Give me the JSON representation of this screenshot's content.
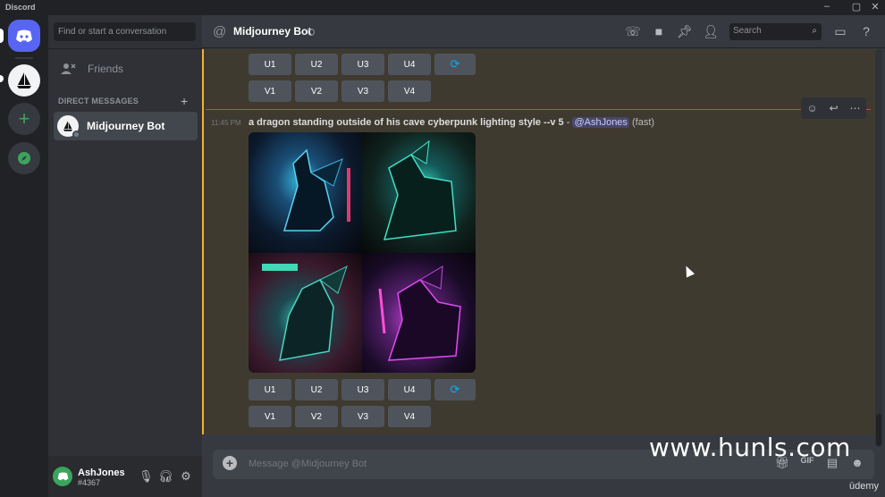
{
  "app": {
    "title": "Discord"
  },
  "dm_search": {
    "placeholder": "Find or start a conversation"
  },
  "friends_label": "Friends",
  "direct_messages_header": "DIRECT MESSAGES",
  "dm_list": [
    {
      "name": "Midjourney Bot"
    }
  ],
  "user": {
    "name": "AshJones",
    "tag": "#4367"
  },
  "channel": {
    "title": "Midjourney Bot"
  },
  "header_search": {
    "placeholder": "Search"
  },
  "upscale_buttons": [
    "U1",
    "U2",
    "U3",
    "U4"
  ],
  "variation_buttons": [
    "V1",
    "V2",
    "V3",
    "V4"
  ],
  "message": {
    "timestamp": "11:45 PM",
    "prompt": "a dragon standing outside of his cave cyberpunk lighting style --v 5",
    "separator": " - ",
    "mention": "@AshJones",
    "mode": "(fast)"
  },
  "composer": {
    "placeholder": "Message @Midjourney Bot"
  },
  "watermark": "www.hunls.com",
  "udemy": "ūdemy",
  "colors": {
    "accent": "#5865f2",
    "highlight_bar": "#f0b232",
    "mention": "#c9cdfb",
    "online": "#3ba55d"
  }
}
